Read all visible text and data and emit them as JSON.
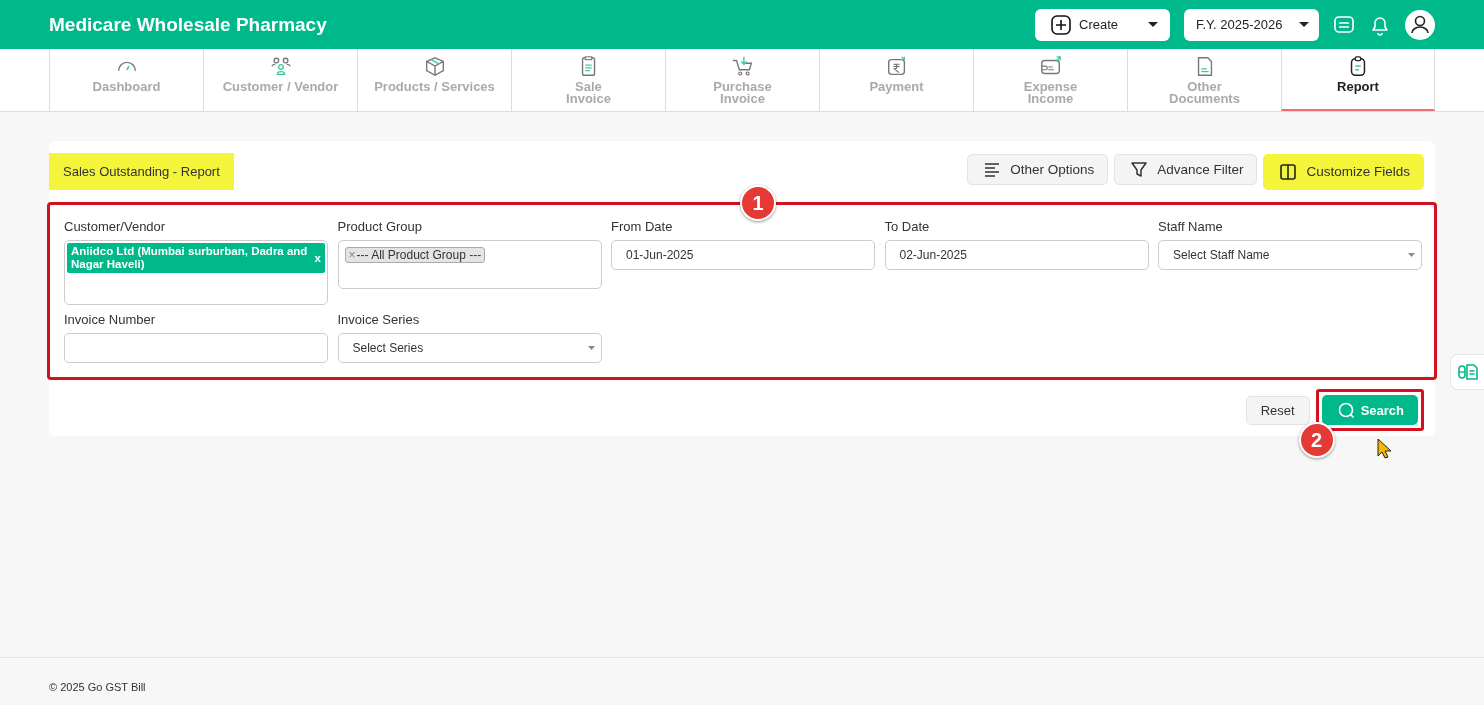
{
  "header": {
    "title": "Medicare Wholesale Pharmacy",
    "create_button": {
      "label": "Create"
    },
    "year_select": {
      "label": "F.Y. 2025-2026"
    }
  },
  "tabs": [
    {
      "label": "Dashboard",
      "selected": false
    },
    {
      "label": "Customer / Vendor",
      "selected": false
    },
    {
      "label": "Products / Services",
      "selected": false
    },
    {
      "label": "Sale\nInvoice",
      "selected": false
    },
    {
      "label": "Purchase\nInvoice",
      "selected": false
    },
    {
      "label": "Payment",
      "selected": false
    },
    {
      "label": "Expense\nIncome",
      "selected": false
    },
    {
      "label": "Other\nDocuments",
      "selected": false
    },
    {
      "label": "Report",
      "selected": true
    }
  ],
  "report": {
    "title": {
      "text": "Sales Outstanding - Report",
      "highlighted": true
    },
    "actions": [
      {
        "label": "Other Options",
        "highlighted": false
      },
      {
        "label": "Advance Filter",
        "highlighted": false
      },
      {
        "label": "Customize Fields",
        "highlighted": true
      }
    ],
    "form": {
      "annotation": "1",
      "fields": [
        {
          "kind": "chipselect",
          "label": "Customer/Vendor",
          "tags": [
            "Aniidco Ltd (Mumbai surburban, Dadra and Nagar Haveli)"
          ],
          "remove": "x"
        },
        {
          "kind": "tokenselect",
          "label": "Product Group",
          "tags": [
            "--- All Product Group ---"
          ],
          "remove": "×"
        },
        {
          "kind": "date",
          "label": "From Date",
          "value": "01-Jun-2025"
        },
        {
          "kind": "date",
          "label": "To Date",
          "value": "02-Jun-2025"
        },
        {
          "kind": "select",
          "label": "Staff Name",
          "placeholder": "Select Staff Name"
        },
        {
          "kind": "text",
          "label": "Invoice Number"
        },
        {
          "kind": "select",
          "label": "Invoice Series",
          "placeholder": "Select Series"
        }
      ]
    },
    "reset_button": {
      "label": "Reset"
    },
    "search_button": {
      "label": "Search",
      "annotation": "2"
    }
  },
  "footer": {
    "text": "© 2025 Go GST Bill"
  }
}
